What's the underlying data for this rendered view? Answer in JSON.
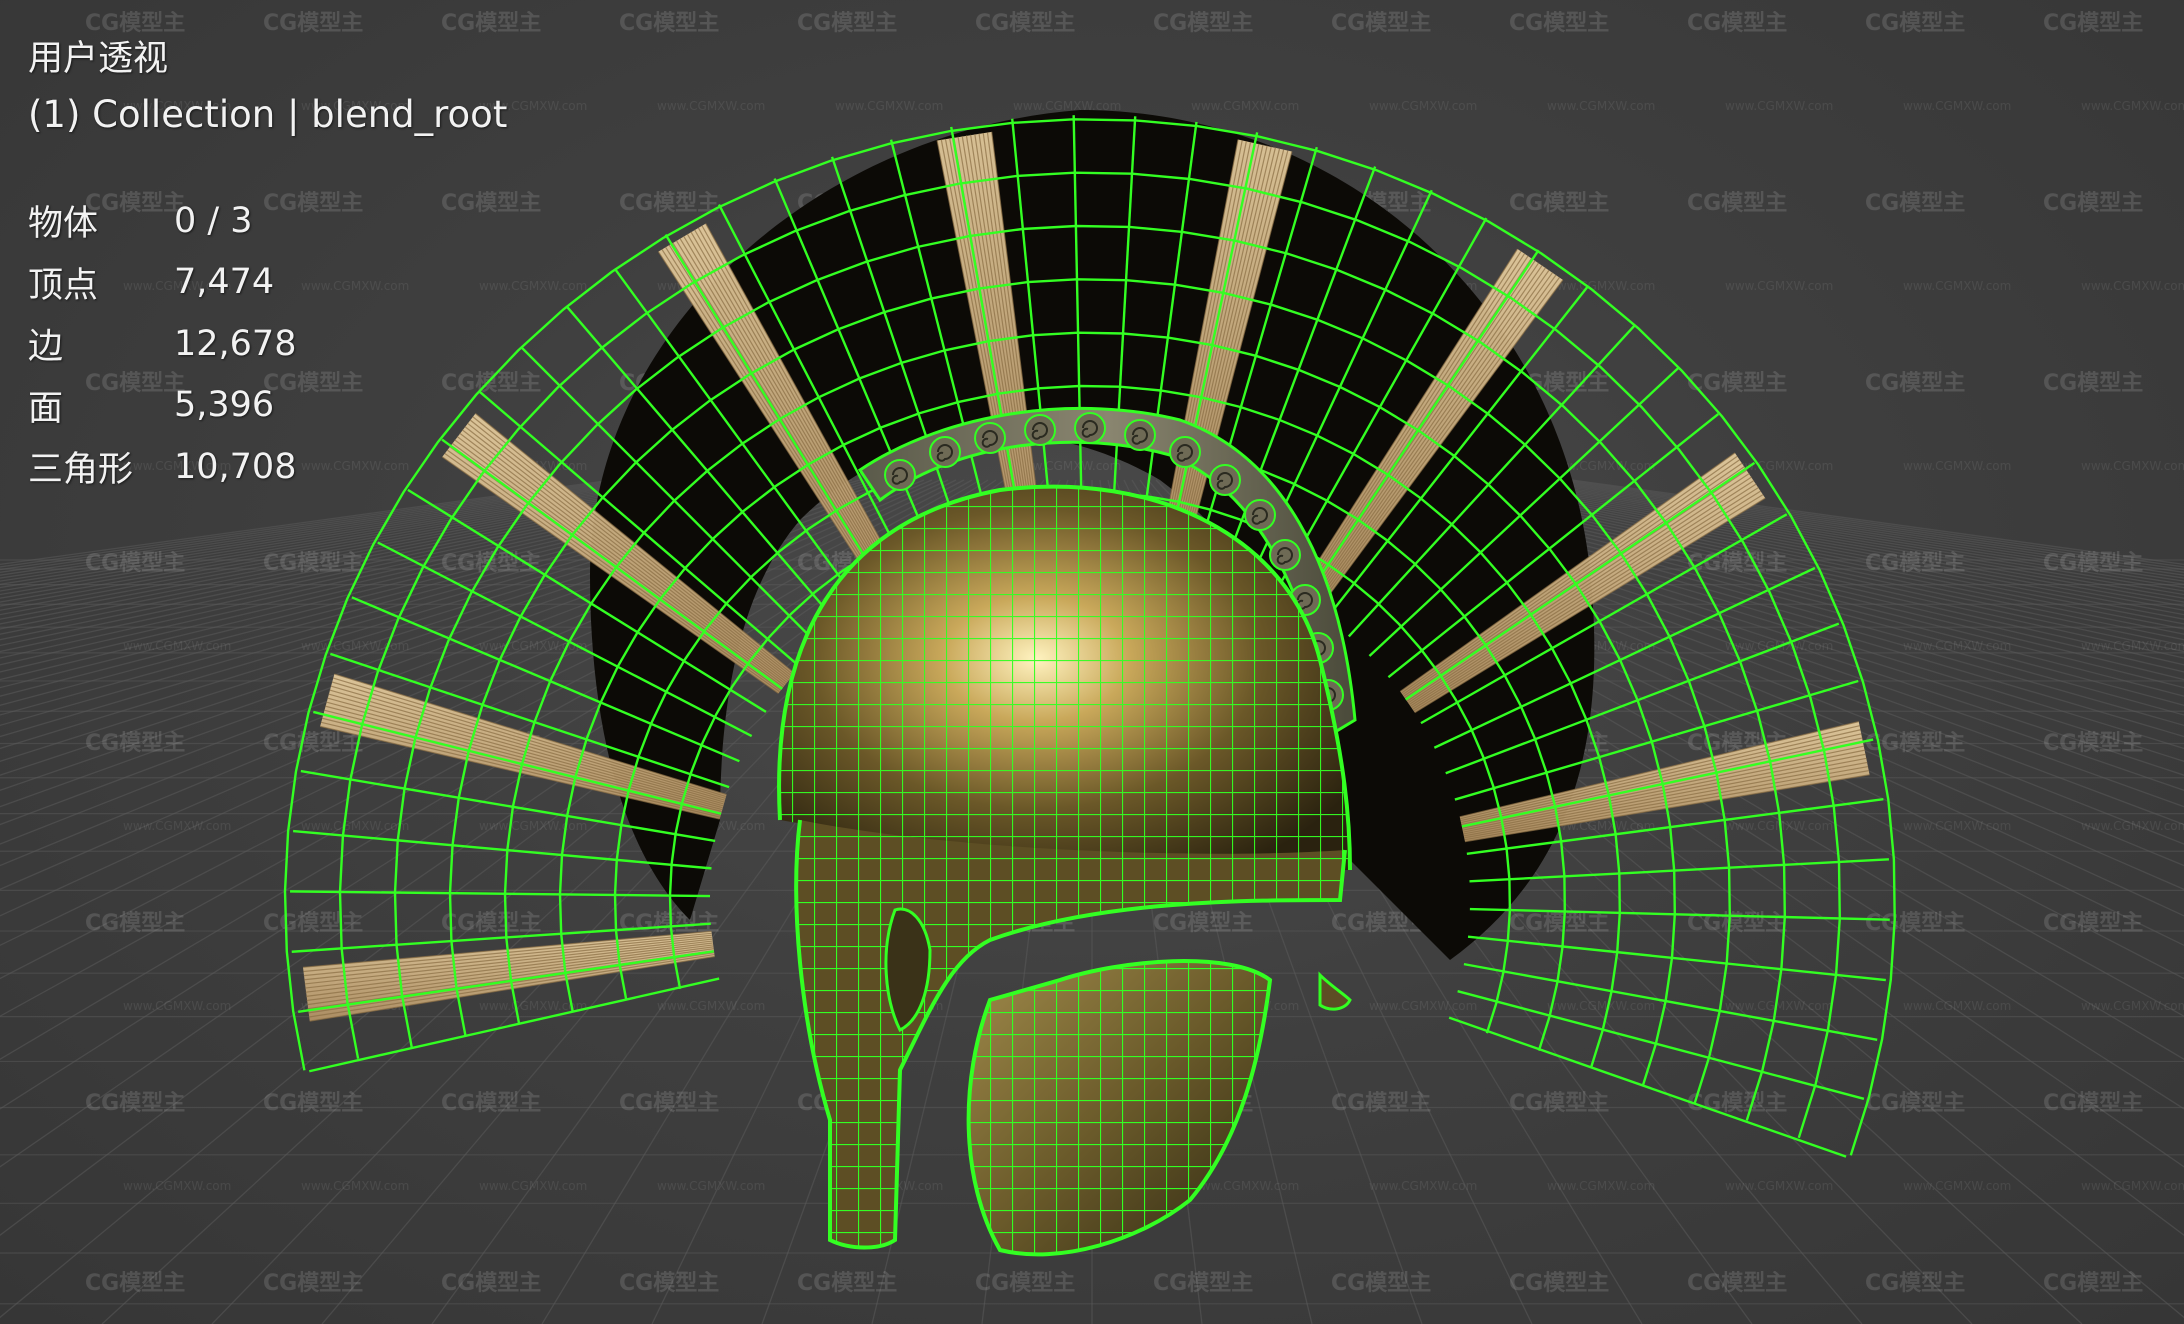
{
  "viewport": {
    "view_name": "用户透视",
    "collection_label": "(1) Collection | blend_root",
    "background_color": "#3d3d3d",
    "wire_color": "#33ff22",
    "grid_color": "#5a5a5a"
  },
  "stats": [
    {
      "label": "物体",
      "value": "0 / 3"
    },
    {
      "label": "顶点",
      "value": "7,474"
    },
    {
      "label": "边",
      "value": "12,678"
    },
    {
      "label": "面",
      "value": "5,396"
    },
    {
      "label": "三角形",
      "value": "10,708"
    }
  ],
  "watermark": {
    "logo_text": "CG模型主",
    "url_text": "www.CGMXW.com"
  },
  "model": {
    "name": "helmet-with-crest",
    "display": "wireframe-over-solid"
  }
}
